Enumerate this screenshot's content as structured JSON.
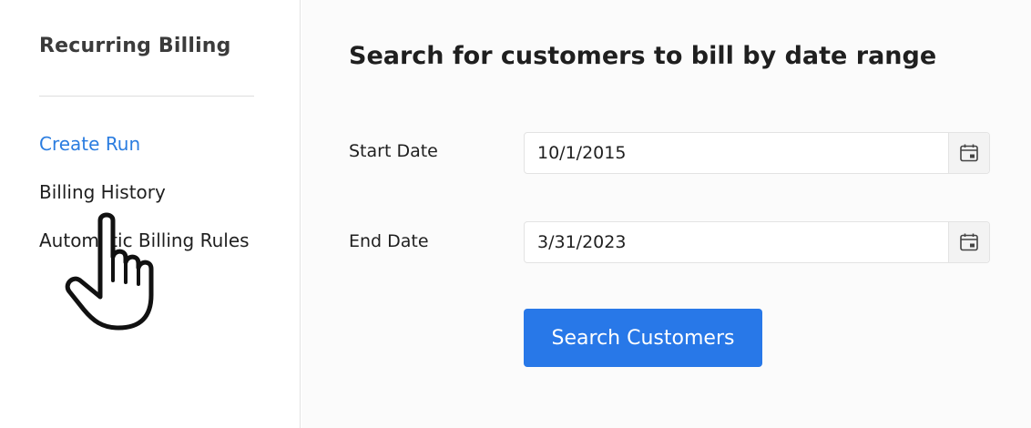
{
  "sidebar": {
    "title": "Recurring Billing",
    "items": [
      {
        "label": "Create Run",
        "active": true
      },
      {
        "label": "Billing History",
        "active": false
      },
      {
        "label": "Automatic Billing Rules",
        "active": false
      }
    ]
  },
  "main": {
    "title": "Search for customers to bill by date range",
    "start_date": {
      "label": "Start Date",
      "value": "10/1/2015"
    },
    "end_date": {
      "label": "End Date",
      "value": "3/31/2023"
    },
    "search_button_label": "Search Customers"
  },
  "icons": {
    "calendar": "calendar-icon",
    "cursor": "hand-pointer-cursor-icon"
  },
  "colors": {
    "accent": "#2878e8",
    "active_link": "#2b7de0",
    "main_background": "#fbfbfb"
  }
}
